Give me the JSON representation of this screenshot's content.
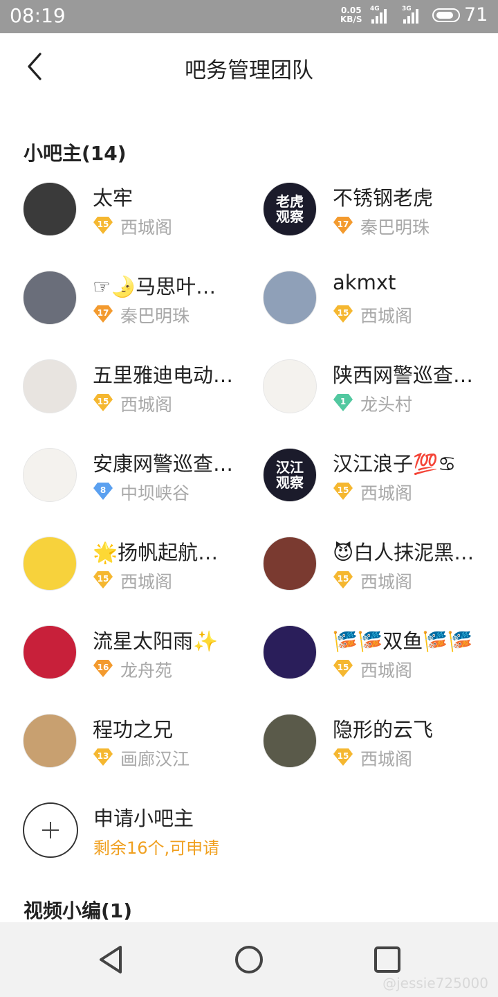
{
  "status_bar": {
    "time": "08:19",
    "net_speed": "0.05",
    "net_unit": "KB/S",
    "signal_1": "4G",
    "signal_2": "3G",
    "battery": "71"
  },
  "header": {
    "title": "吧务管理团队"
  },
  "section_admins": {
    "title": "小吧主(14)"
  },
  "members": [
    {
      "name": "太牢",
      "level": "15",
      "forum": "西城阁",
      "badge_color": "#f5b730",
      "avatar_color": "#3a3a3a",
      "avatar_text": ""
    },
    {
      "name": "不锈钢老虎",
      "level": "17",
      "forum": "秦巴明珠",
      "badge_color": "#f39a2e",
      "avatar_color": "#1b1b2b",
      "avatar_text": "老虎\n观察"
    },
    {
      "name": "☞🌛马思叶…",
      "level": "17",
      "forum": "秦巴明珠",
      "badge_color": "#f39a2e",
      "avatar_color": "#6a6e7a",
      "avatar_text": ""
    },
    {
      "name": "akmxt",
      "level": "15",
      "forum": "西城阁",
      "badge_color": "#f5b730",
      "avatar_color": "#8fa0b8",
      "avatar_text": ""
    },
    {
      "name": "五里雅迪电动…",
      "level": "15",
      "forum": "西城阁",
      "badge_color": "#f5b730",
      "avatar_color": "#e8e4e0",
      "avatar_text": ""
    },
    {
      "name": "陕西网警巡查…",
      "level": "1",
      "forum": "龙头村",
      "badge_color": "#52c8a0",
      "avatar_color": "#f4f2ee",
      "avatar_text": ""
    },
    {
      "name": "安康网警巡查…",
      "level": "8",
      "forum": "中坝峡谷",
      "badge_color": "#5aa0f0",
      "avatar_color": "#f4f2ee",
      "avatar_text": ""
    },
    {
      "name": "汉江浪子💯♋",
      "level": "15",
      "forum": "西城阁",
      "badge_color": "#f5b730",
      "avatar_color": "#1b1b2b",
      "avatar_text": "汉江\n观察"
    },
    {
      "name": "🌟扬帆起航…",
      "level": "15",
      "forum": "西城阁",
      "badge_color": "#f5b730",
      "avatar_color": "#f7d23c",
      "avatar_text": ""
    },
    {
      "name": "😈白人抹泥黑…",
      "level": "15",
      "forum": "西城阁",
      "badge_color": "#f5b730",
      "avatar_color": "#7a3a30",
      "avatar_text": ""
    },
    {
      "name": "流星太阳雨✨",
      "level": "16",
      "forum": "龙舟苑",
      "badge_color": "#f39a2e",
      "avatar_color": "#c8203a",
      "avatar_text": ""
    },
    {
      "name": "🎏🎏双鱼🎏🎏",
      "level": "15",
      "forum": "西城阁",
      "badge_color": "#f5b730",
      "avatar_color": "#2a1e5a",
      "avatar_text": ""
    },
    {
      "name": "程功之兄",
      "level": "13",
      "forum": "画廊汉江",
      "badge_color": "#f5b730",
      "avatar_color": "#c8a070",
      "avatar_text": ""
    },
    {
      "name": "隐形的云飞",
      "level": "15",
      "forum": "西城阁",
      "badge_color": "#f5b730",
      "avatar_color": "#5a5a4a",
      "avatar_text": ""
    }
  ],
  "apply": {
    "label": "申请小吧主",
    "sub": "剩余16个,可申请"
  },
  "section_video": {
    "title": "视频小编(1)"
  },
  "watermark": "@jessie725000"
}
